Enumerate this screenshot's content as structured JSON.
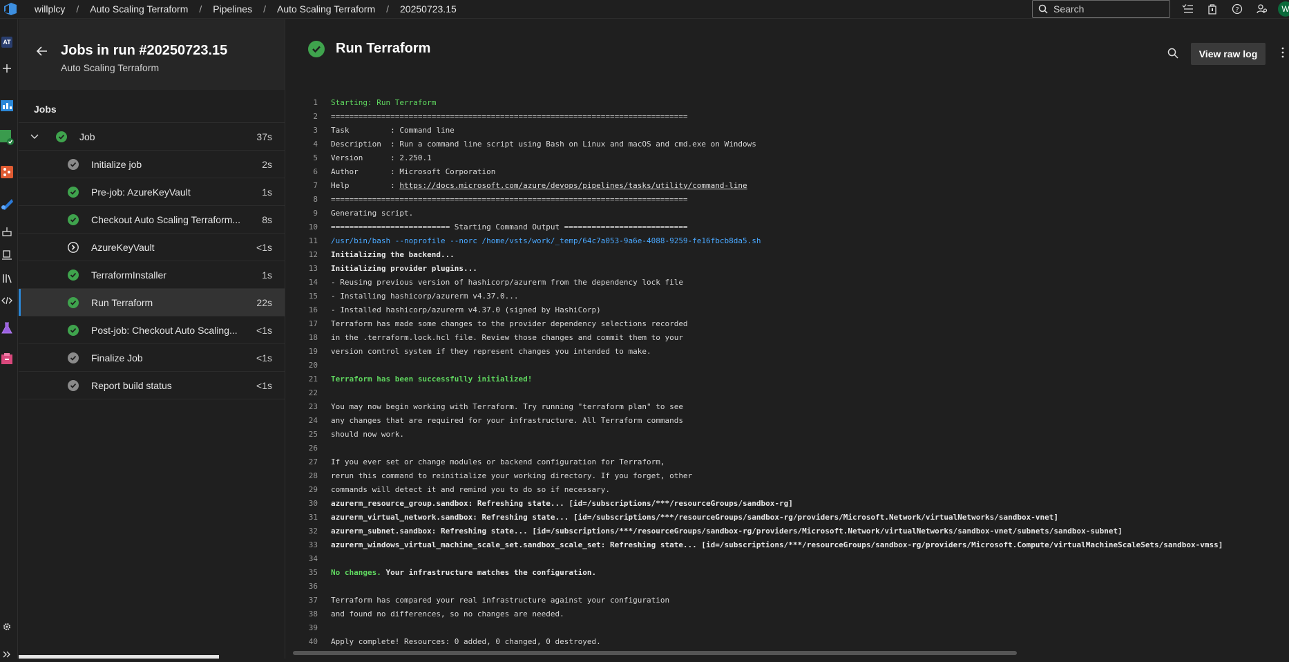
{
  "breadcrumbs": [
    "willplcy",
    "Auto Scaling Terraform",
    "Pipelines",
    "Auto Scaling Terraform",
    "20250723.15"
  ],
  "search": {
    "placeholder": "Search"
  },
  "user": {
    "initial": "W"
  },
  "rail": {
    "badge": "AT"
  },
  "jobs_panel": {
    "title": "Jobs in run #20250723.15",
    "subtitle": "Auto Scaling Terraform",
    "section_label": "Jobs",
    "job": {
      "label": "Job",
      "duration": "37s"
    },
    "steps": [
      {
        "label": "Initialize job",
        "duration": "2s",
        "status": "done-gray"
      },
      {
        "label": "Pre-job: AzureKeyVault",
        "duration": "1s",
        "status": "success"
      },
      {
        "label": "Checkout Auto Scaling Terraform...",
        "duration": "8s",
        "status": "success"
      },
      {
        "label": "AzureKeyVault",
        "duration": "<1s",
        "status": "skipped"
      },
      {
        "label": "TerraformInstaller",
        "duration": "1s",
        "status": "success"
      },
      {
        "label": "Run Terraform",
        "duration": "22s",
        "status": "success",
        "selected": true
      },
      {
        "label": "Post-job: Checkout Auto Scaling...",
        "duration": "<1s",
        "status": "success"
      },
      {
        "label": "Finalize Job",
        "duration": "<1s",
        "status": "done-gray"
      },
      {
        "label": "Report build status",
        "duration": "<1s",
        "status": "done-gray"
      }
    ]
  },
  "main": {
    "title": "Run Terraform",
    "raw_log_label": "View raw log"
  },
  "log_lines": [
    {
      "n": "1",
      "t": "Starting: Run Terraform",
      "style": "green"
    },
    {
      "n": "2",
      "t": "==============================================================================",
      "style": ""
    },
    {
      "n": "3",
      "t": "Task         : Command line",
      "style": ""
    },
    {
      "n": "4",
      "t": "Description  : Run a command line script using Bash on Linux and macOS and cmd.exe on Windows",
      "style": ""
    },
    {
      "n": "5",
      "t": "Version      : 2.250.1",
      "style": ""
    },
    {
      "n": "6",
      "t": "Author       : Microsoft Corporation",
      "style": ""
    },
    {
      "n": "7",
      "t": "Help         : ",
      "link": "https://docs.microsoft.com/azure/devops/pipelines/tasks/utility/command-line",
      "style": ""
    },
    {
      "n": "8",
      "t": "==============================================================================",
      "style": ""
    },
    {
      "n": "9",
      "t": "Generating script.",
      "style": ""
    },
    {
      "n": "10",
      "t": "========================== Starting Command Output ===========================",
      "style": ""
    },
    {
      "n": "11",
      "t": "/usr/bin/bash --noprofile --norc /home/vsts/work/_temp/64c7a053-9a6e-4088-9259-fe16fbcb8da5.sh",
      "style": "blue"
    },
    {
      "n": "12",
      "t": "Initializing the backend...",
      "style": "bold"
    },
    {
      "n": "13",
      "t": "Initializing provider plugins...",
      "style": "bold"
    },
    {
      "n": "14",
      "t": "- Reusing previous version of hashicorp/azurerm from the dependency lock file",
      "style": ""
    },
    {
      "n": "15",
      "t": "- Installing hashicorp/azurerm v4.37.0...",
      "style": ""
    },
    {
      "n": "16",
      "t": "- Installed hashicorp/azurerm v4.37.0 (signed by HashiCorp)",
      "style": ""
    },
    {
      "n": "17",
      "t": "Terraform has made some changes to the provider dependency selections recorded",
      "style": ""
    },
    {
      "n": "18",
      "t": "in the .terraform.lock.hcl file. Review those changes and commit them to your",
      "style": ""
    },
    {
      "n": "19",
      "t": "version control system if they represent changes you intended to make.",
      "style": ""
    },
    {
      "n": "20",
      "t": "",
      "style": ""
    },
    {
      "n": "21",
      "t": "Terraform has been successfully initialized!",
      "style": "bgreen"
    },
    {
      "n": "22",
      "t": "",
      "style": ""
    },
    {
      "n": "23",
      "t": "You may now begin working with Terraform. Try running \"terraform plan\" to see",
      "style": ""
    },
    {
      "n": "24",
      "t": "any changes that are required for your infrastructure. All Terraform commands",
      "style": ""
    },
    {
      "n": "25",
      "t": "should now work.",
      "style": ""
    },
    {
      "n": "26",
      "t": "",
      "style": ""
    },
    {
      "n": "27",
      "t": "If you ever set or change modules or backend configuration for Terraform,",
      "style": ""
    },
    {
      "n": "28",
      "t": "rerun this command to reinitialize your working directory. If you forget, other",
      "style": ""
    },
    {
      "n": "29",
      "t": "commands will detect it and remind you to do so if necessary.",
      "style": ""
    },
    {
      "n": "30",
      "t": "azurerm_resource_group.sandbox: Refreshing state... [id=/subscriptions/***/resourceGroups/sandbox-rg]",
      "style": "bold"
    },
    {
      "n": "31",
      "t": "azurerm_virtual_network.sandbox: Refreshing state... [id=/subscriptions/***/resourceGroups/sandbox-rg/providers/Microsoft.Network/virtualNetworks/sandbox-vnet]",
      "style": "bold"
    },
    {
      "n": "32",
      "t": "azurerm_subnet.sandbox: Refreshing state... [id=/subscriptions/***/resourceGroups/sandbox-rg/providers/Microsoft.Network/virtualNetworks/sandbox-vnet/subnets/sandbox-subnet]",
      "style": "bold"
    },
    {
      "n": "33",
      "t": "azurerm_windows_virtual_machine_scale_set.sandbox_scale_set: Refreshing state... [id=/subscriptions/***/resourceGroups/sandbox-rg/providers/Microsoft.Compute/virtualMachineScaleSets/sandbox-vmss]",
      "style": "bold"
    },
    {
      "n": "34",
      "t": "",
      "style": ""
    },
    {
      "n": "35",
      "t": "No changes.",
      "rest": " Your infrastructure matches the configuration.",
      "style": "nochange"
    },
    {
      "n": "36",
      "t": "",
      "style": ""
    },
    {
      "n": "37",
      "t": "Terraform has compared your real infrastructure against your configuration",
      "style": ""
    },
    {
      "n": "38",
      "t": "and found no differences, so no changes are needed.",
      "style": ""
    },
    {
      "n": "39",
      "t": "",
      "style": ""
    },
    {
      "n": "40",
      "t": "Apply complete! Resources: 0 added, 0 changed, 0 destroyed.",
      "style": ""
    }
  ],
  "colors": {
    "success": "#3fa34d",
    "accent": "#2b88d8",
    "link_blue": "#4aa8ff",
    "log_green": "#5fd75f"
  }
}
